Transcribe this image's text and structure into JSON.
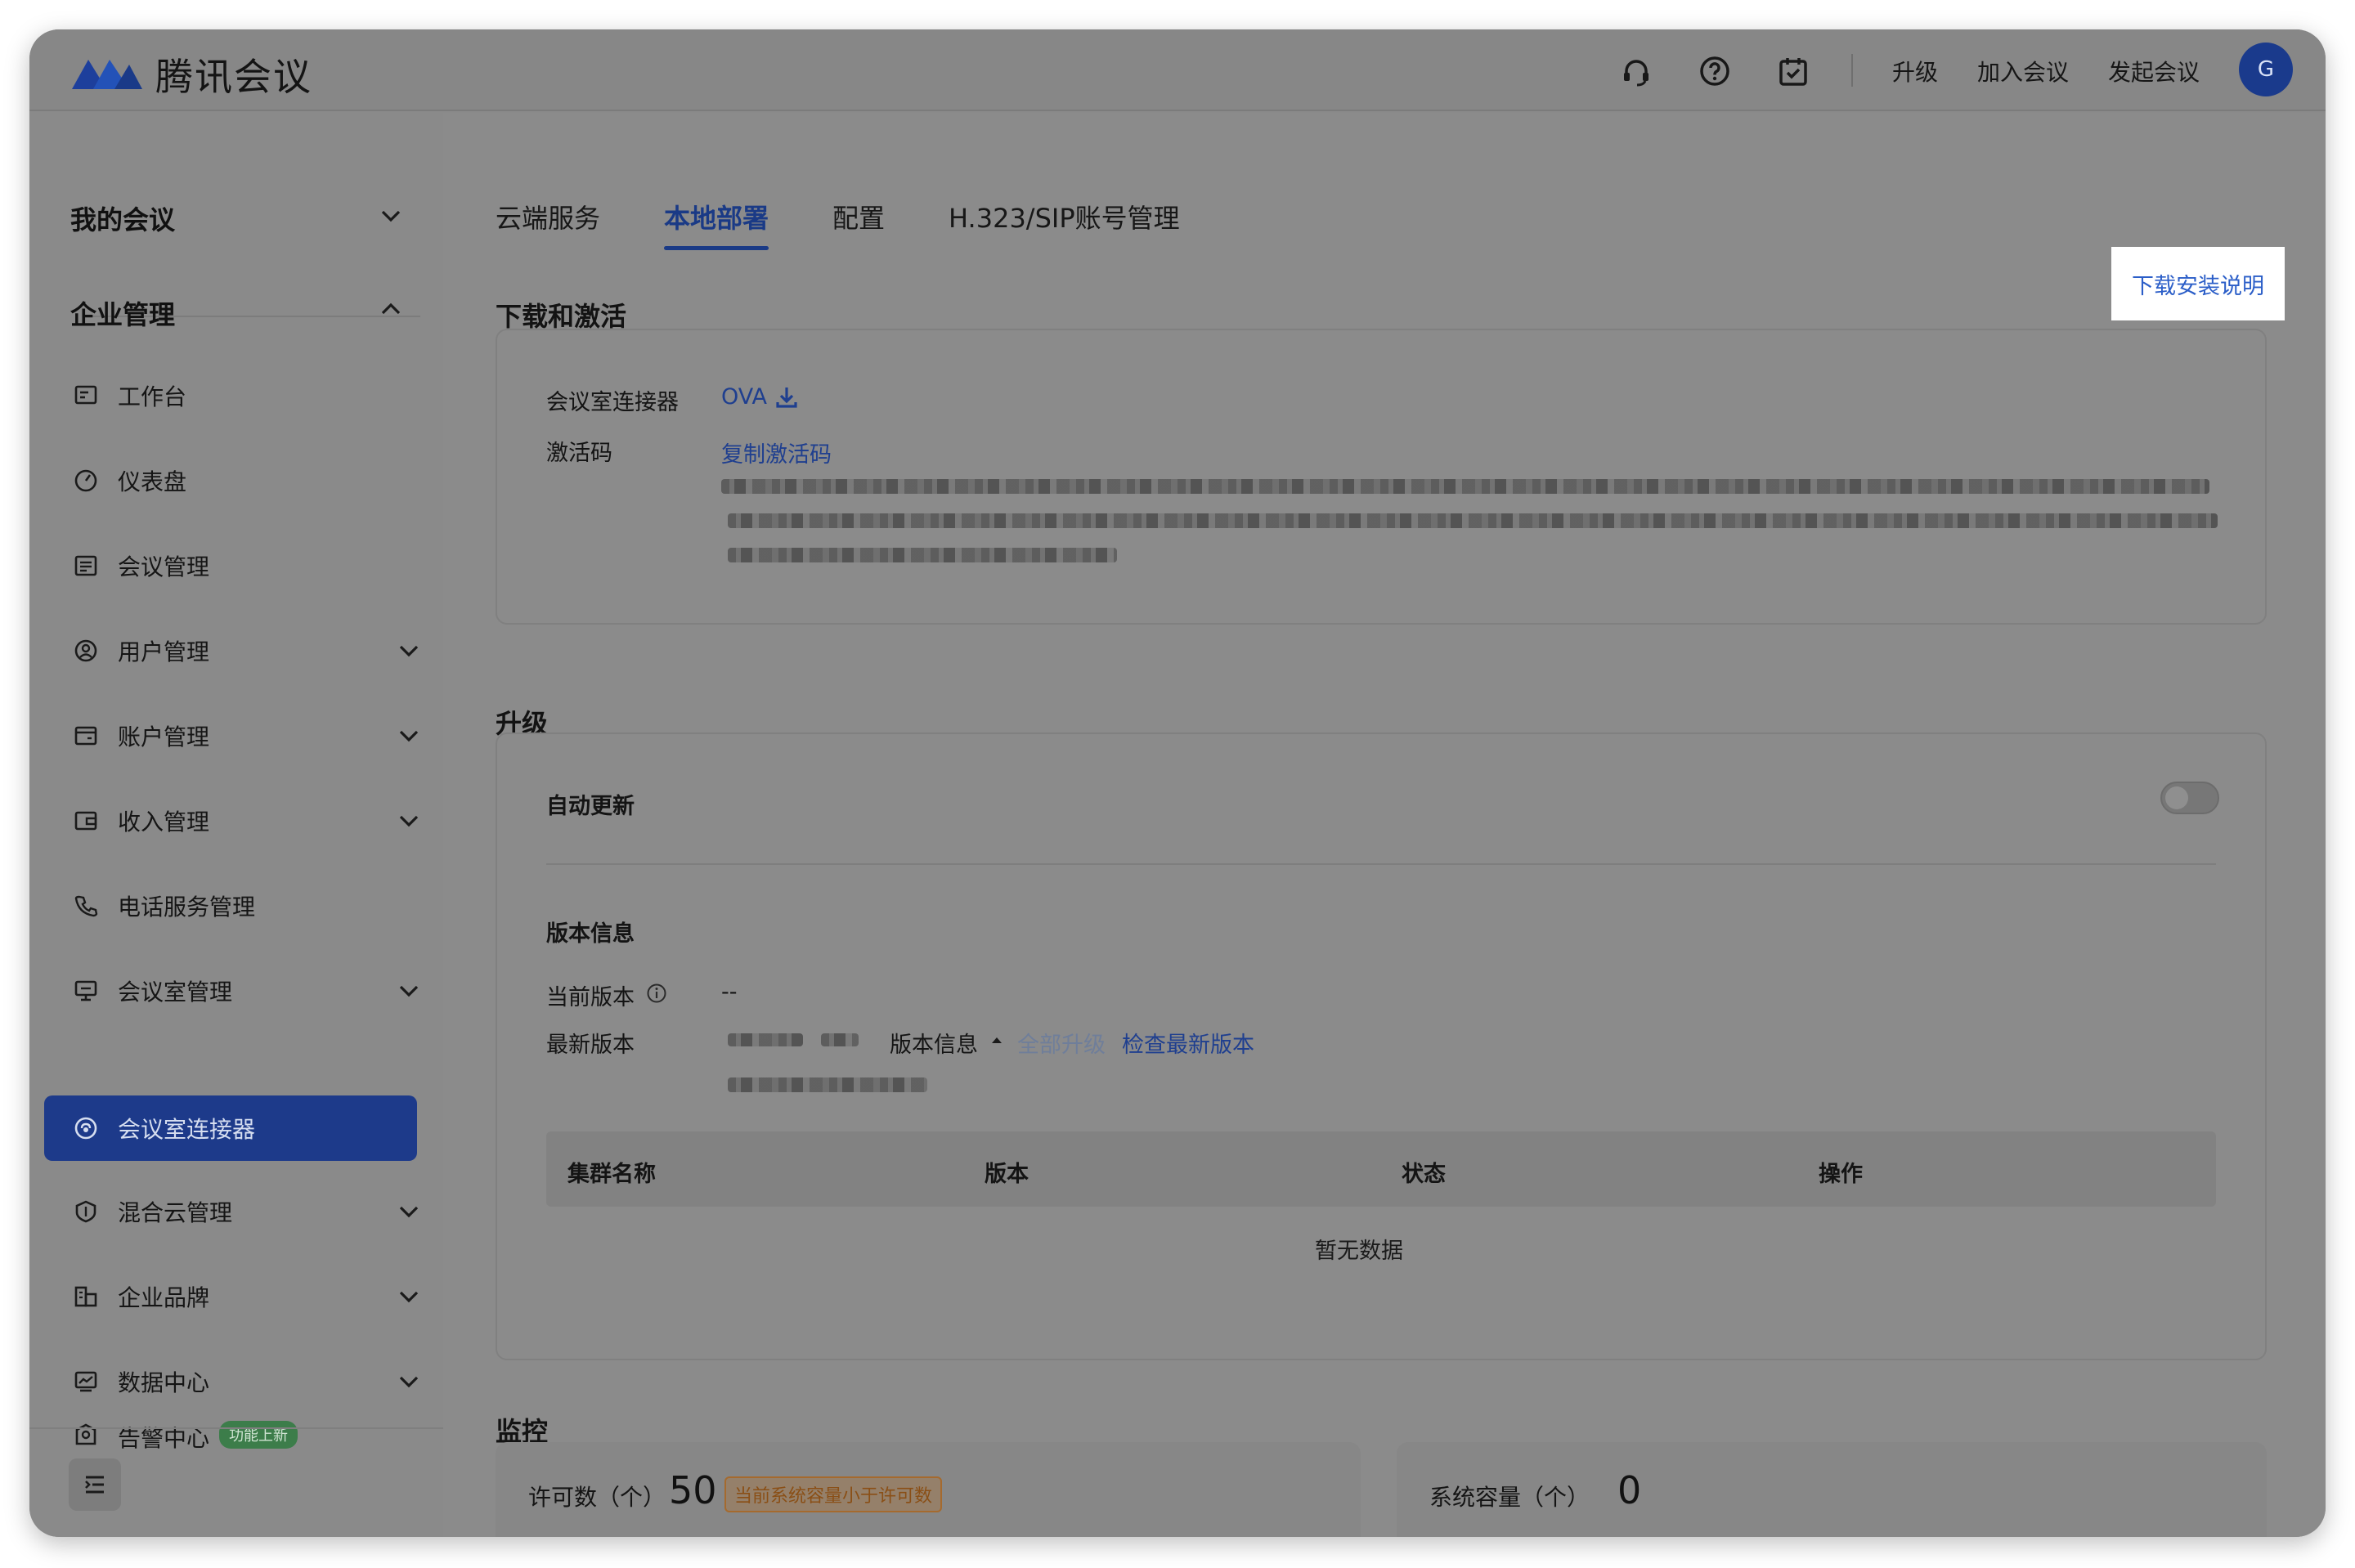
{
  "app": {
    "name": "腾讯会议",
    "user_initial": "G"
  },
  "header": {
    "icons": [
      "headset-icon",
      "help-icon",
      "calendar-check-icon"
    ],
    "links": [
      "升级",
      "加入会议",
      "发起会议"
    ]
  },
  "sidebar": {
    "group_my_meetings": "我的会议",
    "group_enterprise": "企业管理",
    "items": [
      {
        "label": "工作台",
        "icon": "workbench-icon"
      },
      {
        "label": "仪表盘",
        "icon": "dashboard-icon"
      },
      {
        "label": "会议管理",
        "icon": "meeting-list-icon"
      },
      {
        "label": "用户管理",
        "icon": "user-icon"
      },
      {
        "label": "账户管理",
        "icon": "account-icon"
      },
      {
        "label": "收入管理",
        "icon": "wallet-icon"
      },
      {
        "label": "电话服务管理",
        "icon": "phone-icon"
      },
      {
        "label": "会议室管理",
        "icon": "room-icon"
      },
      {
        "label": "会议室连接器",
        "icon": "connector-icon"
      },
      {
        "label": "混合云管理",
        "icon": "hybrid-cloud-icon"
      },
      {
        "label": "企业品牌",
        "icon": "brand-icon"
      },
      {
        "label": "数据中心",
        "icon": "data-icon"
      },
      {
        "label": "告警中心",
        "icon": "alarm-icon",
        "badge": "功能上新"
      }
    ]
  },
  "tabs": [
    "云端服务",
    "本地部署",
    "配置",
    "H.323/SIP账号管理"
  ],
  "active_tab": "本地部署",
  "download": {
    "title": "下载和激活",
    "guide_link": "下载安装说明",
    "connector_label": "会议室连接器",
    "ova_link": "OVA",
    "activation_label": "激活码",
    "copy_link": "复制激活码"
  },
  "upgrade": {
    "title": "升级",
    "auto_update_label": "自动更新",
    "auto_update_on": false,
    "version_info_title": "版本信息",
    "current_version_label": "当前版本",
    "current_version_value": "--",
    "latest_version_label": "最新版本",
    "version_info_toggle": "版本信息",
    "upgrade_all": "全部升级",
    "check_latest": "检查最新版本",
    "table_headers": [
      "集群名称",
      "版本",
      "状态",
      "操作"
    ],
    "empty_text": "暂无数据"
  },
  "monitor": {
    "title": "监控",
    "license_label": "许可数（个）",
    "license_value": "50",
    "warning_badge": "当前系统容量小于许可数",
    "capacity_label": "系统容量（个）",
    "capacity_value": "0"
  }
}
